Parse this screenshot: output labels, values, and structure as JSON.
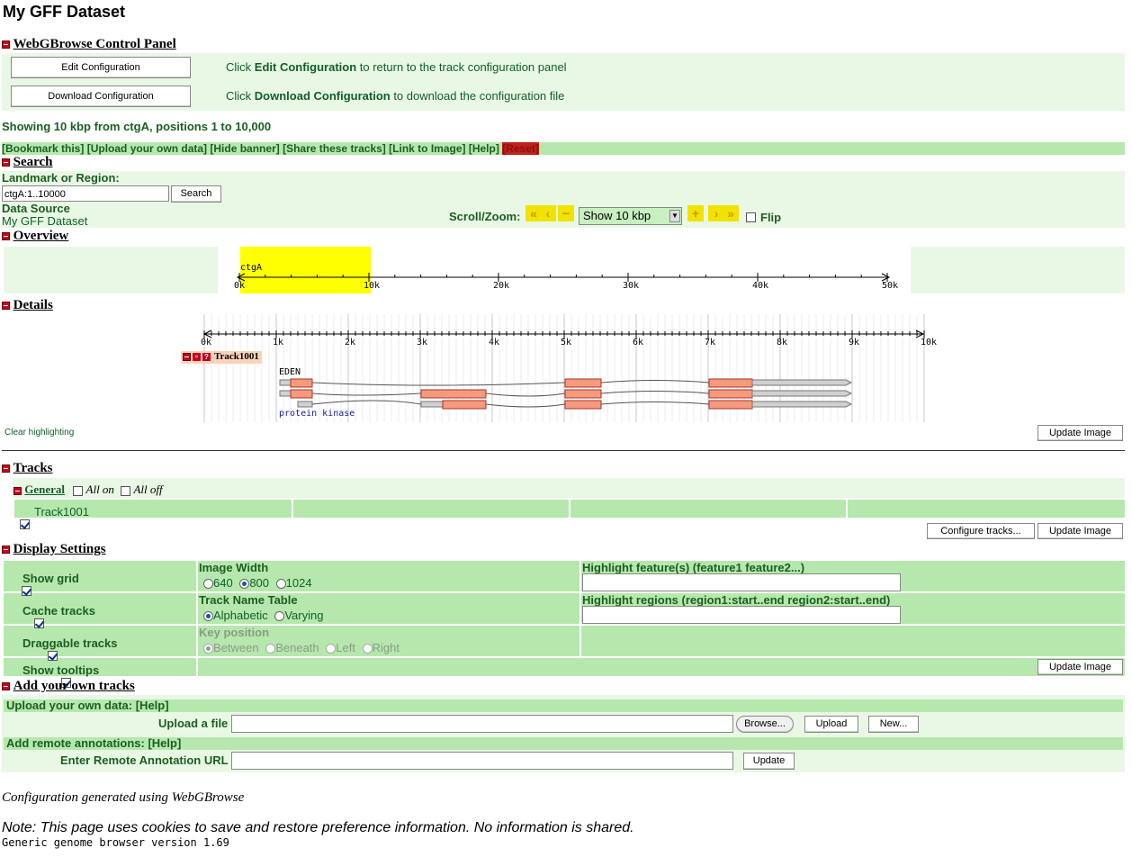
{
  "page_title": "My GFF Dataset",
  "control_panel": {
    "title": "WebGBrowse Control Panel",
    "edit_button": "Edit Configuration",
    "download_button": "Download Configuration",
    "edit_text_pre": "Click ",
    "edit_text_bold": "Edit Configuration",
    "edit_text_post": " to return to the track configuration panel",
    "download_text_pre": "Click ",
    "download_text_bold": "Download Configuration",
    "download_text_post": " to download the configuration file"
  },
  "showing": "Showing 10 kbp from ctgA, positions 1 to 10,000",
  "links": {
    "bookmark": "[Bookmark this]",
    "upload": "[Upload your own data]",
    "hide_banner": "[Hide banner]",
    "share": "[Share these tracks]",
    "link_image": "[Link to Image]",
    "help": "[Help]",
    "reset": "[Reset]"
  },
  "search": {
    "title": "Search",
    "landmark_label": "Landmark or Region:",
    "input_value": "ctgA:1..10000",
    "button": "Search",
    "data_source_label": "Data Source",
    "data_source_value": "My GFF Dataset",
    "scroll_zoom_label": "Scroll/Zoom:",
    "zoom_select": "Show 10 kbp",
    "flip_label": "Flip"
  },
  "overview": {
    "title": "Overview",
    "contig": "ctgA",
    "ticks": [
      "0k",
      "10k",
      "20k",
      "30k",
      "40k",
      "50k"
    ],
    "highlight_range": [
      0,
      10000
    ]
  },
  "details": {
    "title": "Details",
    "ticks": [
      "0k",
      "1k",
      "2k",
      "3k",
      "4k",
      "5k",
      "6k",
      "7k",
      "8k",
      "9k",
      "10k"
    ],
    "track_label": "Track1001",
    "feature_top_label": "EDEN",
    "feature_bottom_label": "protein kinase",
    "clear_highlighting": "Clear highlighting",
    "update_button": "Update Image"
  },
  "tracks": {
    "title": "Tracks",
    "group": "General",
    "all_on": "All on",
    "all_off": "All off",
    "track_name": "Track1001",
    "configure_button": "Configure tracks...",
    "update_button": "Update Image"
  },
  "display_settings": {
    "title": "Display Settings",
    "show_grid": "Show grid",
    "cache_tracks": "Cache tracks",
    "draggable_tracks": "Draggable tracks",
    "show_tooltips": "Show tooltips",
    "image_width_label": "Image Width",
    "width_640": "640",
    "width_800": "800",
    "width_1024": "1024",
    "track_name_table_label": "Track Name Table",
    "alphabetic": "Alphabetic",
    "varying": "Varying",
    "key_position_label": "Key position",
    "between": "Between",
    "beneath": "Beneath",
    "left": "Left",
    "right": "Right",
    "highlight_features_label": "Highlight feature(s) (feature1 feature2...)",
    "highlight_regions_label": "Highlight regions (region1:start..end region2:start..end)",
    "update_button": "Update Image"
  },
  "add_tracks": {
    "title": "Add your own tracks",
    "upload_header": "Upload your own data: [Help]",
    "upload_label": "Upload a file",
    "browse_button": "Browse...",
    "upload_button": "Upload",
    "new_button": "New...",
    "remote_header": "Add remote annotations: [Help]",
    "remote_label": "Enter Remote Annotation URL",
    "update_button": "Update"
  },
  "footer": {
    "generated": "Configuration generated using WebGBrowse",
    "note": "Note: This page uses cookies to save and restore preference information. No information is shared.",
    "version": "Generic genome browser version 1.69"
  },
  "colors": {
    "panel_bg": "#e9f8e4",
    "bar_bg": "#b6e8ad",
    "text_green": "#1b5e20",
    "overview_highlight": "#ffff00",
    "exon": "#f59a7a",
    "utr": "#d0d0d0"
  }
}
